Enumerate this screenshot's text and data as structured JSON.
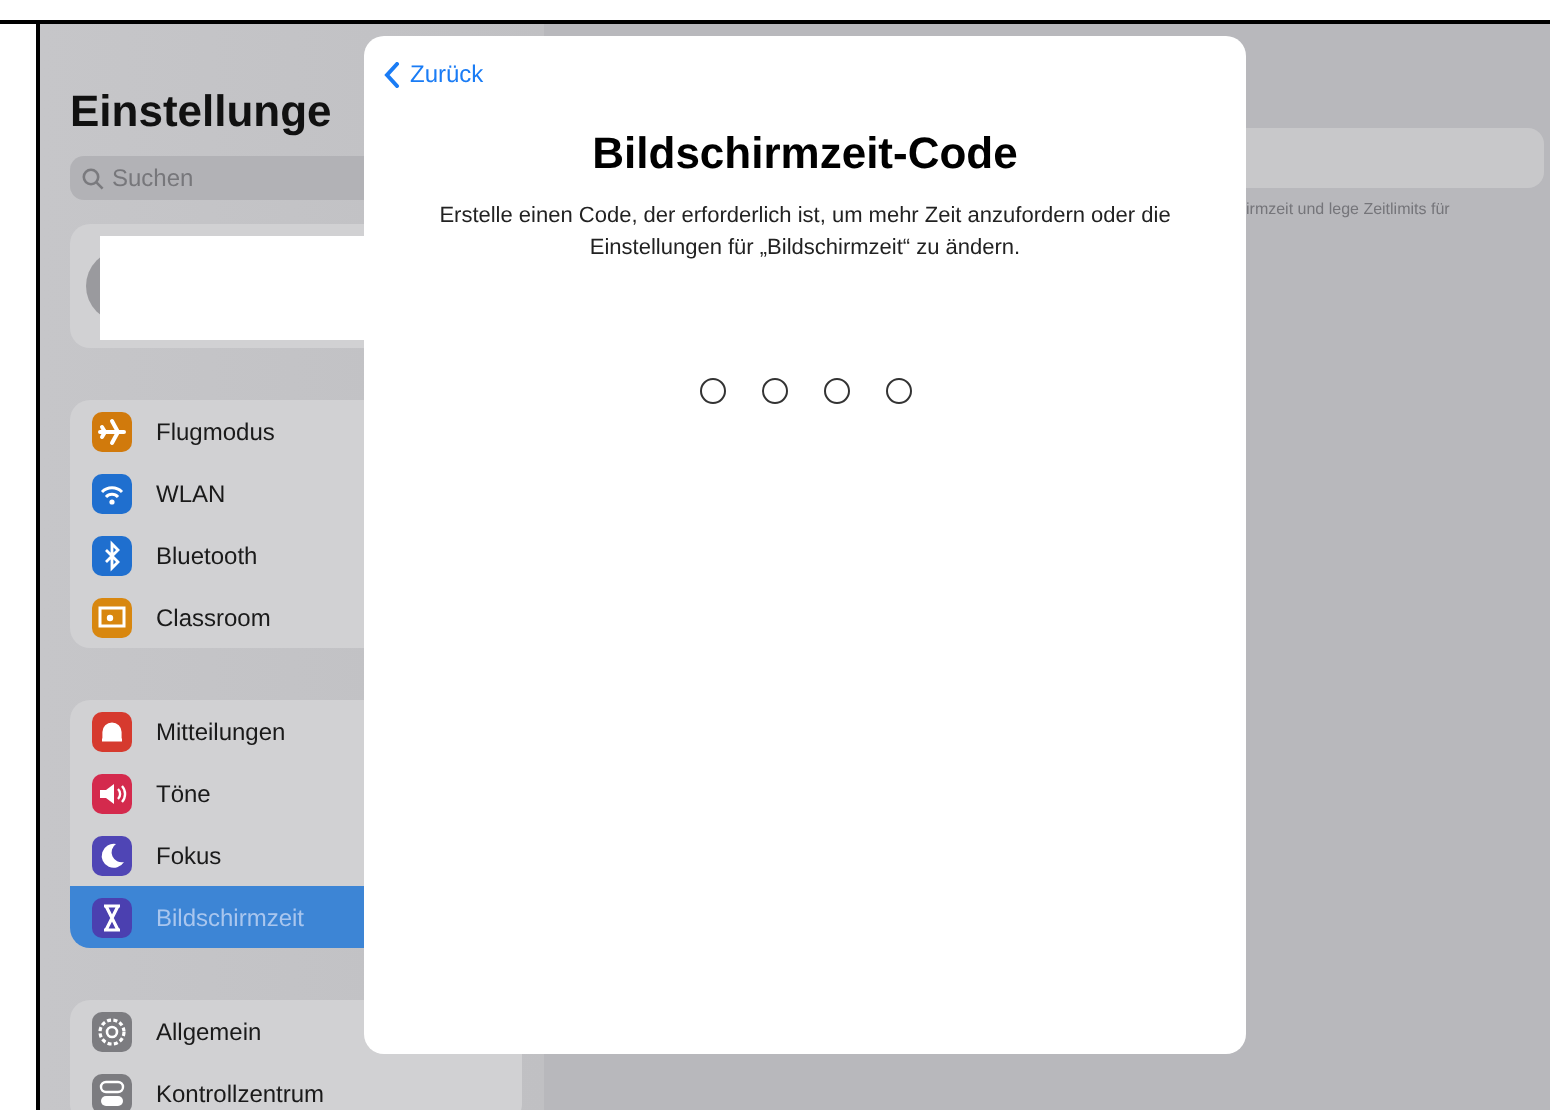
{
  "sidebar": {
    "title": "Einstellunge",
    "search": {
      "placeholder": "Suchen"
    },
    "groups": [
      {
        "items": [
          {
            "label": "Flugmodus",
            "selected": false
          },
          {
            "label": "WLAN",
            "selected": false
          },
          {
            "label": "Bluetooth",
            "selected": false
          },
          {
            "label": "Classroom",
            "selected": false
          }
        ]
      },
      {
        "items": [
          {
            "label": "Mitteilungen",
            "selected": false
          },
          {
            "label": "Töne",
            "selected": false
          },
          {
            "label": "Fokus",
            "selected": false
          },
          {
            "label": "Bildschirmzeit",
            "selected": true
          }
        ]
      },
      {
        "items": [
          {
            "label": "Allgemein",
            "selected": false
          },
          {
            "label": "Kontrollzentrum",
            "selected": false
          }
        ]
      }
    ]
  },
  "detail": {
    "description": "irmzeit und lege Zeitlimits für"
  },
  "dialog": {
    "back": "Zurück",
    "title": "Bildschirmzeit-Code",
    "message": "Erstelle einen Code, der erforderlich ist, um mehr Zeit anzufordern oder die Einstellungen für „Bildschirmzeit“ zu ändern.",
    "code_digits": [
      {
        "filled": false
      },
      {
        "filled": false
      },
      {
        "filled": false
      },
      {
        "filled": false
      }
    ]
  }
}
